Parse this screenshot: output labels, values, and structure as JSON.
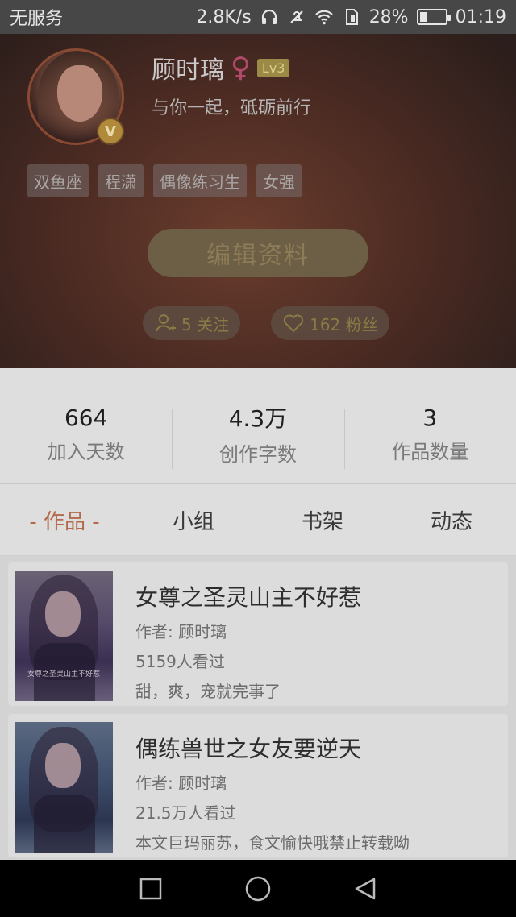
{
  "status_bar": {
    "carrier": "无服务",
    "speed": "2.8K/s",
    "battery": "28%",
    "battery_level": 0.28,
    "time": "01:19",
    "icons": [
      "headphones-icon",
      "mute-icon",
      "wifi-icon",
      "sim-icon",
      "battery-icon"
    ]
  },
  "profile": {
    "name": "顾时璃",
    "gender_symbol": "♀",
    "level": "Lv3",
    "verified_badge": "V",
    "signature": "与你一起，砥砺前行",
    "tags": [
      "双鱼座",
      "程潇",
      "偶像练习生",
      "女强"
    ],
    "edit_label": "编辑资料",
    "following": "5 关注",
    "followers": "162 粉丝"
  },
  "stats": [
    {
      "value": "664",
      "label": "加入天数"
    },
    {
      "value": "4.3万",
      "label": "创作字数"
    },
    {
      "value": "3",
      "label": "作品数量"
    }
  ],
  "tabs": [
    {
      "label": "- 作品 -",
      "active": true
    },
    {
      "label": "小组",
      "active": false
    },
    {
      "label": "书架",
      "active": false
    },
    {
      "label": "动态",
      "active": false
    }
  ],
  "works": [
    {
      "title": "女尊之圣灵山主不好惹",
      "author": "作者: 顾时璃",
      "views": "5159人看过",
      "desc": "甜，爽，宠就完事了",
      "cover_text": "女尊之圣灵山主不好惹"
    },
    {
      "title": "偶练兽世之女友要逆天",
      "author": "作者: 顾时璃",
      "views": "21.5万人看过",
      "desc": "本文巨玛丽苏，食文愉快哦禁止转载呦",
      "cover_text": ""
    }
  ],
  "colors": {
    "accent": "#b26a4a",
    "gold": "#9a8a45"
  }
}
